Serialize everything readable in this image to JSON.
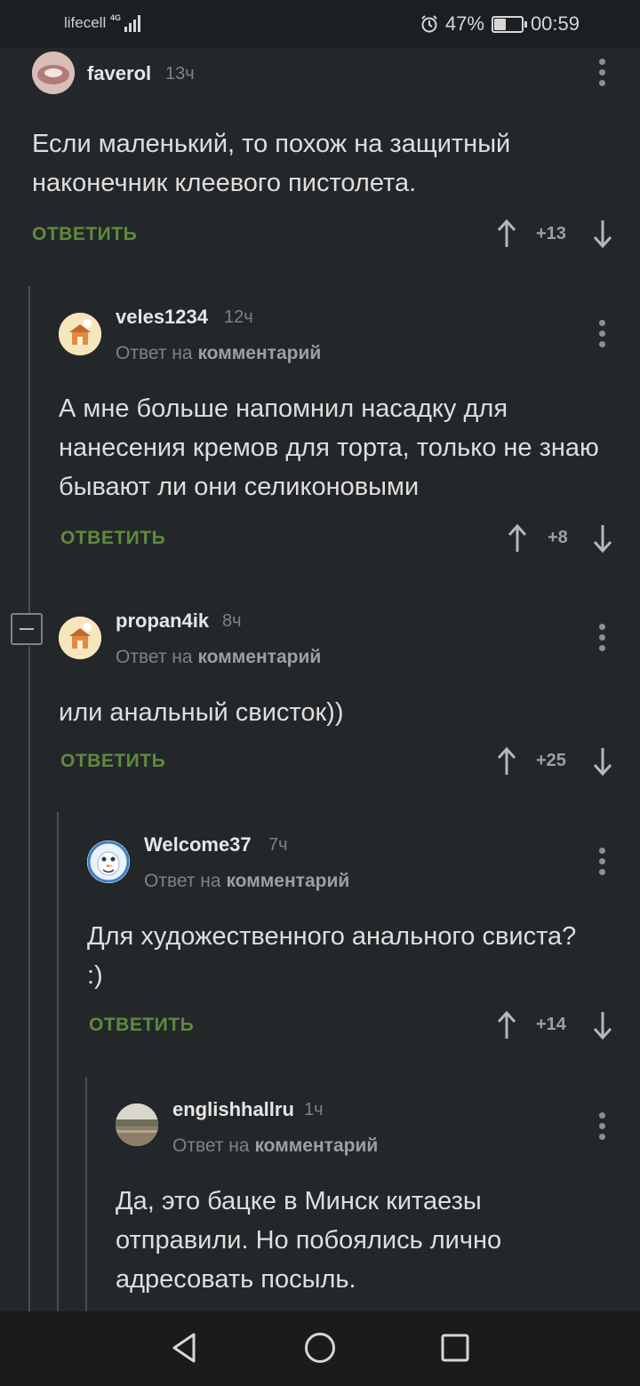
{
  "status_bar": {
    "carrier": "lifecell",
    "network": "4G",
    "battery": "47%",
    "battery_level": 0.47,
    "time": "00:59"
  },
  "labels": {
    "reply_to_prefix": "Ответ на",
    "reply_to_target": "комментарий",
    "reply_button": "ОТВЕТИТЬ"
  },
  "comments": [
    {
      "author": "faverol",
      "time": "13ч",
      "text": "Если маленький, то похож на защитный наконечник клеевого пистолета.",
      "score": "+13"
    },
    {
      "author": "veles1234",
      "time": "12ч",
      "text": "А мне больше напомнил насадку для нанесения кремов для торта, только не знаю бывают ли они селиконовыми",
      "score": "+8"
    },
    {
      "author": "propan4ik",
      "time": "8ч",
      "text": "или анальный свисток))",
      "score": "+25"
    },
    {
      "author": "Welcome37",
      "time": "7ч",
      "text": "Для художественного анального свиста? :)",
      "score": "+14"
    },
    {
      "author": "englishhallru",
      "time": "1ч",
      "text": "Да, это бацке в Минск китаезы отправили. Но побоялись лично адресовать посыль."
    }
  ]
}
